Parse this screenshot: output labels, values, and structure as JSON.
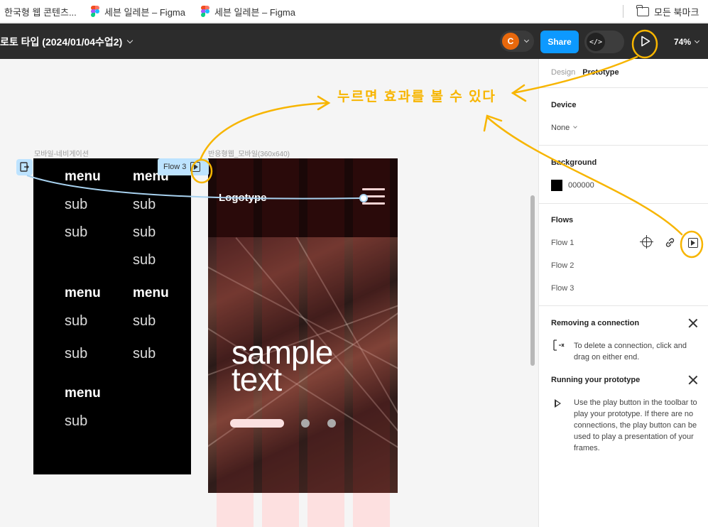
{
  "bookmarks": {
    "items": [
      {
        "label": "한국형 웹 콘텐츠..."
      },
      {
        "label": "세븐 일레븐 – Figma"
      },
      {
        "label": "세븐 일레븐 – Figma"
      }
    ],
    "all_bookmarks": "모든 북마크"
  },
  "toolbar": {
    "file_title": "로토 타입 (2024/01/04수업2)",
    "avatar_initial": "C",
    "share_label": "Share",
    "dev_mode_glyph": "</>",
    "zoom": "74%"
  },
  "colors": {
    "accent": "#0d99ff",
    "avatar": "#e8680c",
    "annotation": "#f7b500",
    "flow_tag": "#bde3ff"
  },
  "canvas": {
    "nav_frame_label": "모바일-네비게이션",
    "mobile_frame_label": "반응형웹_모바일(360x640)",
    "flow_tag_label": "Flow 3",
    "nav_menu": {
      "col1": [
        "menu",
        "sub",
        "sub",
        "menu",
        "sub",
        "sub",
        "menu",
        "sub"
      ],
      "col2": [
        "menu",
        "sub",
        "sub",
        "sub",
        "menu",
        "sub",
        "sub"
      ]
    },
    "mobile": {
      "logotype": "Logotype",
      "hero_line1": "sample",
      "hero_line2": "text"
    },
    "annotation": "누르면 효과를 볼 수 있다"
  },
  "panel": {
    "tabs": [
      "Design",
      "Prototype"
    ],
    "device_title": "Device",
    "device_value": "None",
    "background_title": "Background",
    "background_hex": "000000",
    "flows_title": "Flows",
    "flows": [
      "Flow 1",
      "Flow 2",
      "Flow 3"
    ],
    "removing_title": "Removing a connection",
    "removing_text": "To delete a connection, click and drag on either end.",
    "running_title": "Running your prototype",
    "running_text": "Use the play button in the toolbar to play your prototype. If there are no connections, the play button can be used to play a presentation of your frames."
  }
}
